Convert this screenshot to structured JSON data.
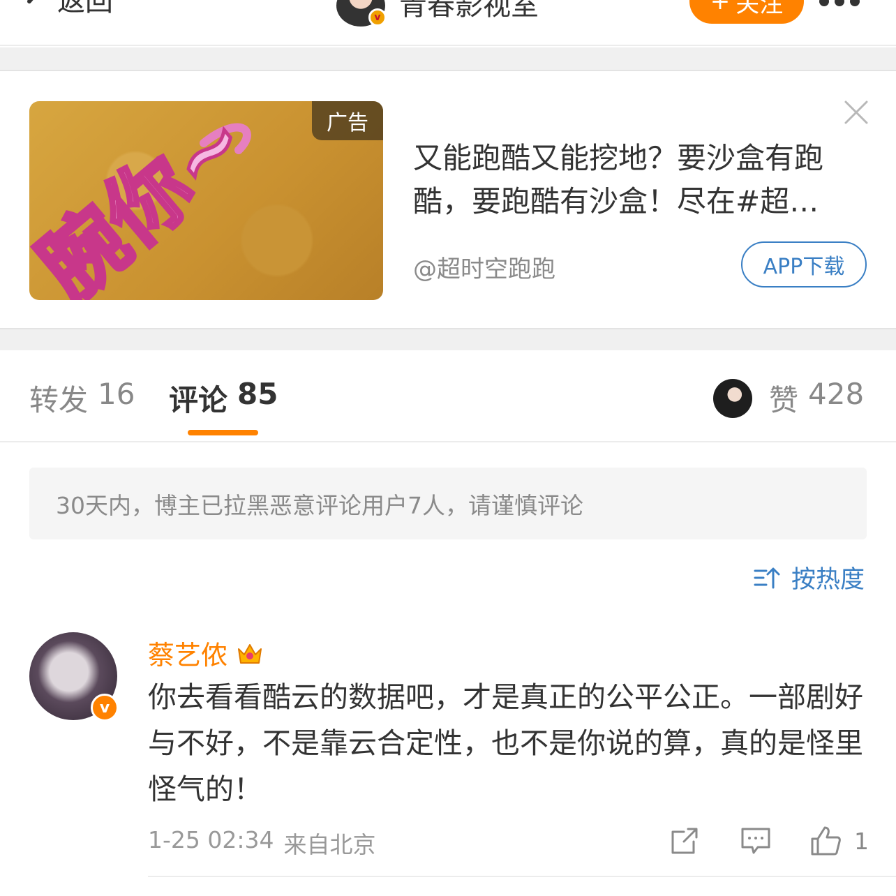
{
  "nav": {
    "back_label": "返回",
    "account_name": "青春影视室",
    "follow_label": "关注",
    "follow_prefix": "+"
  },
  "ad": {
    "badge": "广告",
    "text": "又能跑酷又能挖地？要沙盒有跑酷，要跑酷有沙盒！尽在#超…",
    "source": "@超时空跑跑",
    "app_button": "APP下载",
    "image_caption": "腕你~"
  },
  "tabs": {
    "repost_label": "转发",
    "repost_count": "16",
    "comment_label": "评论",
    "comment_count": "85",
    "like_label": "赞",
    "like_count": "428"
  },
  "notice": "30天内，博主已拉黑恶意评论用户7人，请谨慎评论",
  "sort_label": "按热度",
  "comment": {
    "username": "蔡艺侬",
    "text": "你去看看酷云的数据吧，才是真正的公平公正。一部剧好与不好，不是靠云合定性，也不是你说的算，真的是怪里怪气的！",
    "time": "1-25 02:34",
    "source": "来自北京",
    "like_count": "1"
  },
  "colors": {
    "accent": "#ff8200",
    "link": "#3a7fc4"
  }
}
